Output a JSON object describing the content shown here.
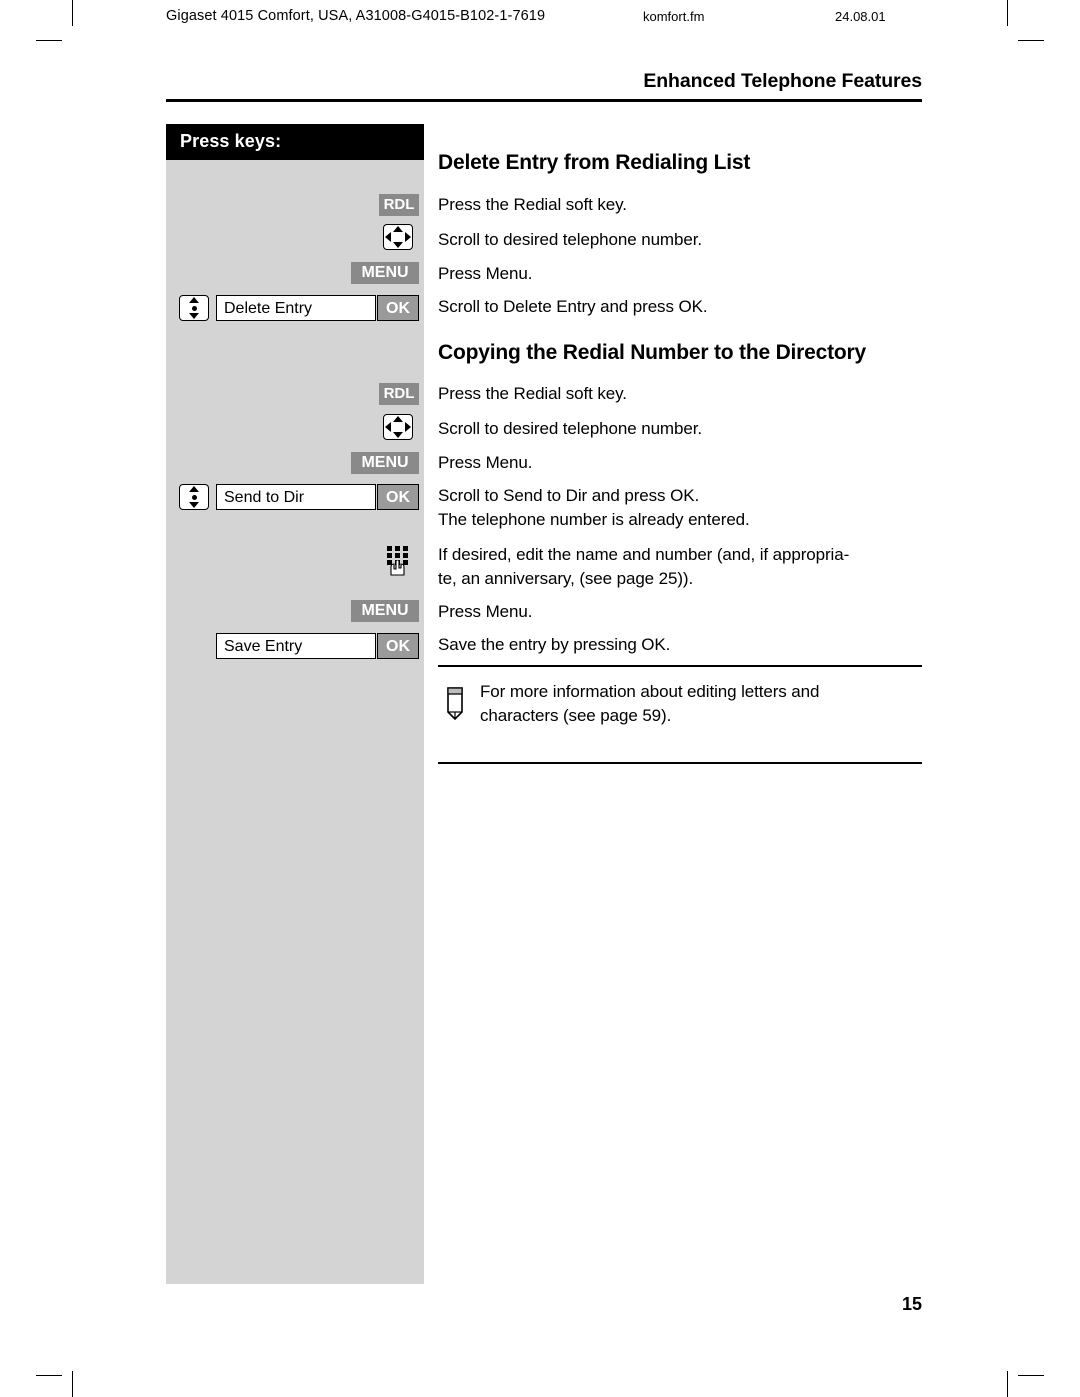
{
  "header": {
    "document_ref": "Gigaset 4015 Comfort, USA, A31008-G4015-B102-1-7619",
    "file_name": "komfort.fm",
    "date": "24.08.01"
  },
  "chapter": {
    "title": "Enhanced Telephone Features"
  },
  "sidebar": {
    "heading": "Press keys:",
    "keys": [
      {
        "id": "rdl-1",
        "type": "softkey",
        "label": "RDL"
      },
      {
        "id": "nav-1",
        "type": "rocker-4way",
        "label": ""
      },
      {
        "id": "menu-1",
        "type": "softkey",
        "label": "MENU"
      },
      {
        "id": "nav-2",
        "type": "rocker-vert",
        "label": ""
      },
      {
        "id": "disp-1",
        "type": "display-label",
        "label": "Delete Entry"
      },
      {
        "id": "ok-1",
        "type": "softkey",
        "label": "OK"
      },
      {
        "id": "rdl-2",
        "type": "softkey",
        "label": "RDL"
      },
      {
        "id": "nav-3",
        "type": "rocker-4way",
        "label": ""
      },
      {
        "id": "menu-2",
        "type": "softkey",
        "label": "MENU"
      },
      {
        "id": "nav-4",
        "type": "rocker-vert",
        "label": ""
      },
      {
        "id": "disp-2",
        "type": "display-label",
        "label": "Send to Dir"
      },
      {
        "id": "ok-2",
        "type": "softkey",
        "label": "OK"
      },
      {
        "id": "pad-1",
        "type": "keypad",
        "label": ""
      },
      {
        "id": "menu-3",
        "type": "softkey",
        "label": "MENU"
      },
      {
        "id": "disp-3",
        "type": "display-label",
        "label": "Save Entry"
      },
      {
        "id": "ok-3",
        "type": "softkey",
        "label": "OK"
      }
    ]
  },
  "sections": [
    {
      "title": "Delete Entry from Redialing List",
      "steps": [
        "Press the Redial soft key.",
        "Scroll to desired telephone number.",
        "Press Menu.",
        "Scroll to Delete Entry and press OK."
      ]
    },
    {
      "title": "Copying the Redial Number to the Directory",
      "steps": [
        "Press the Redial soft key.",
        "Scroll to desired telephone number.",
        "Press Menu.",
        "Scroll to Send to Dir and press OK.",
        "The telephone number is already entered.",
        "If desired, edit the name and number (and, if appropria-",
        "te, an anniversary, (see page 25)).",
        "Press Menu.",
        "Save the entry by pressing OK."
      ]
    }
  ],
  "note": {
    "line1": "For more information about editing letters and",
    "line2": "characters (see page 59)."
  },
  "footer": {
    "page_number": "15"
  }
}
